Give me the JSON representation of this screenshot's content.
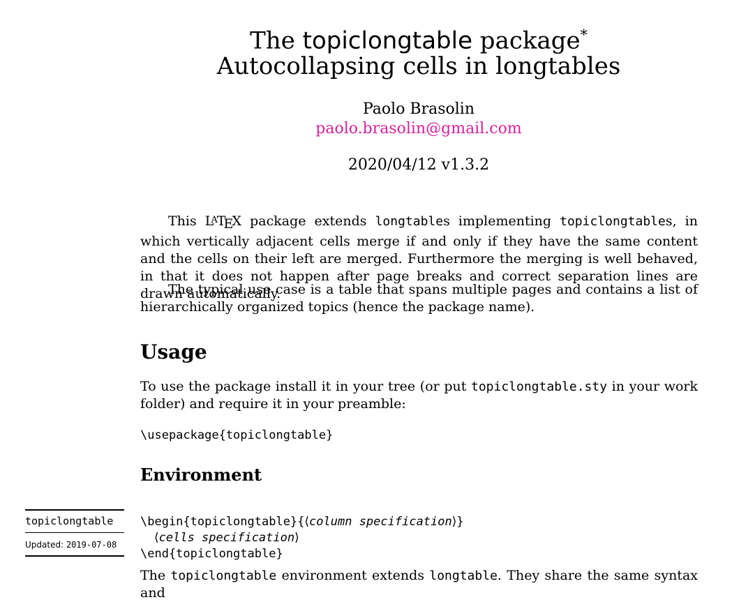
{
  "title": {
    "prefix": "The ",
    "package_name": "topiclongtable",
    "suffix": " package",
    "footnote_mark": "*",
    "subtitle": "Autocollapsing cells in longtables"
  },
  "author": {
    "name": "Paolo Brasolin",
    "email": "paolo.brasolin@gmail.com"
  },
  "date_version": "2020/04/12 v1.3.2",
  "abstract": {
    "p1_a": "This ",
    "p1_latex": "LaTeX",
    "p1_b": " package extends ",
    "p1_code1": "longtable",
    "p1_c": "s implementing ",
    "p1_code2": "topiclongtable",
    "p1_d": "s, in which vertically adjacent cells merge if and only if they have the same content and the cells on their left are merged. Furthermore the merging is well behaved, in that it does not happen after page breaks and correct separation lines are drawn automatically.",
    "p2": "The typical use case is a table that spans multiple pages and contains a list of hierarchically organized topics (hence the package name)."
  },
  "usage": {
    "heading": "Usage",
    "p_a": "To use the package install it in your tree (or put ",
    "p_code": "topiclongtable.sty",
    "p_b": " in your work folder) and require it in your preamble:",
    "code": "\\usepackage{topiclongtable}"
  },
  "environment": {
    "heading": "Environment",
    "margin_name": "topiclongtable",
    "updated_label": "Updated:",
    "updated_date": "2019-07-08",
    "code_begin": "\\begin{topiclongtable}{",
    "code_arg": "column specification",
    "code_begin_end": "}",
    "code_cells": "cells specification",
    "code_end": "\\end{topiclongtable}",
    "desc_a": "The ",
    "desc_code1": "topiclongtable",
    "desc_b": " environment extends ",
    "desc_code2": "longtable",
    "desc_c": ". They share the same syntax and"
  }
}
